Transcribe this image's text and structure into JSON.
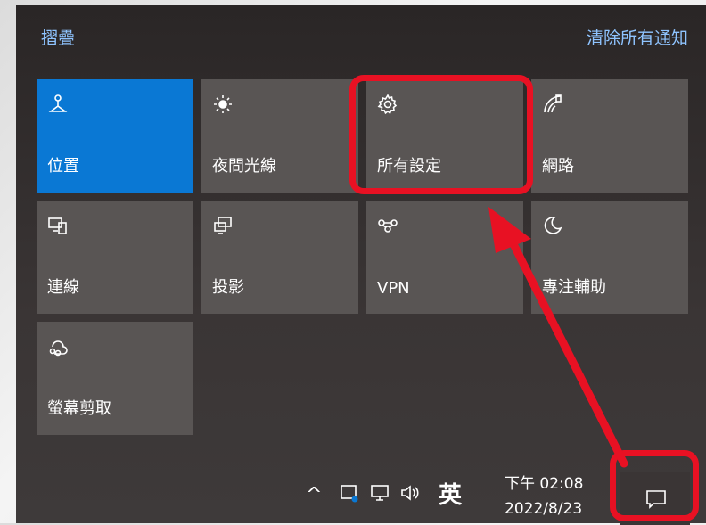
{
  "header": {
    "collapse_label": "摺疊",
    "clear_label": "清除所有通知"
  },
  "tiles": [
    {
      "label": "位置",
      "icon": "location-icon",
      "active": true
    },
    {
      "label": "夜間光線",
      "icon": "night-light-icon",
      "active": false
    },
    {
      "label": "所有設定",
      "icon": "settings-gear-icon",
      "active": false
    },
    {
      "label": "網路",
      "icon": "network-icon",
      "active": false
    },
    {
      "label": "連線",
      "icon": "connect-icon",
      "active": false
    },
    {
      "label": "投影",
      "icon": "project-icon",
      "active": false
    },
    {
      "label": "VPN",
      "icon": "vpn-icon",
      "active": false
    },
    {
      "label": "專注輔助",
      "icon": "focus-assist-icon",
      "active": false
    },
    {
      "label": "螢幕剪取",
      "icon": "screen-snip-icon",
      "active": false
    }
  ],
  "taskbar": {
    "chevron": "^",
    "ime_label": "英",
    "time": "下午 02:08",
    "date": "2022/8/23"
  },
  "colors": {
    "accent": "#0a78d4",
    "tile_bg": "#595554",
    "highlight": "#e81123",
    "link": "#8fc4ff"
  }
}
